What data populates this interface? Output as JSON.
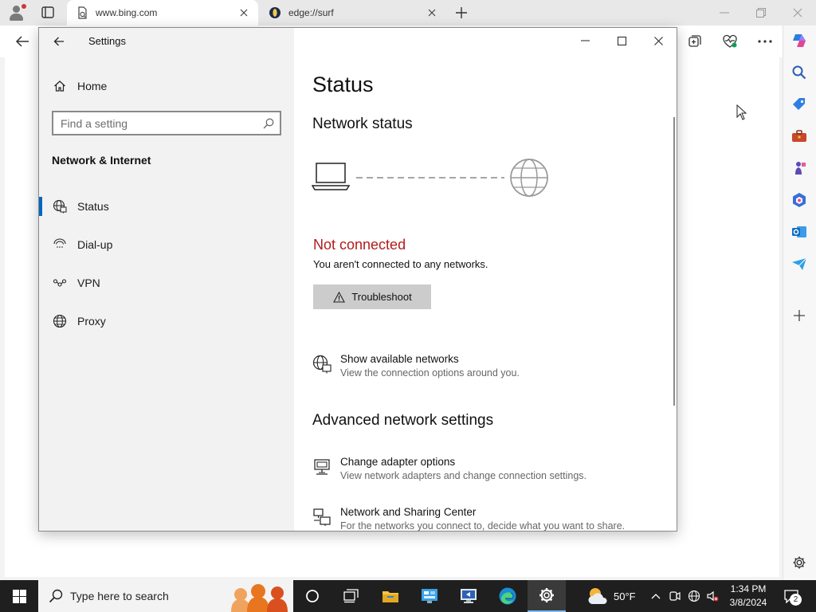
{
  "browser": {
    "tabs": [
      {
        "title": "www.bing.com",
        "active": true
      },
      {
        "title": "edge://surf",
        "active": false
      }
    ]
  },
  "settings": {
    "app_title": "Settings",
    "home_label": "Home",
    "search_placeholder": "Find a setting",
    "section_title": "Network & Internet",
    "nav_items": [
      {
        "label": "Status",
        "icon": "globe-grid-icon",
        "selected": true
      },
      {
        "label": "Dial-up",
        "icon": "dial-up-icon",
        "selected": false
      },
      {
        "label": "VPN",
        "icon": "vpn-icon",
        "selected": false
      },
      {
        "label": "Proxy",
        "icon": "globe-icon",
        "selected": false
      }
    ],
    "page_title": "Status",
    "network_status_heading": "Network status",
    "connection_state": "Not connected",
    "connection_description": "You aren't connected to any networks.",
    "troubleshoot_label": "Troubleshoot",
    "show_networks": {
      "title": "Show available networks",
      "description": "View the connection options around you."
    },
    "advanced_heading": "Advanced network settings",
    "advanced_items": [
      {
        "title": "Change adapter options",
        "description": "View network adapters and change connection settings.",
        "icon": "adapter-icon"
      },
      {
        "title": "Network and Sharing Center",
        "description": "For the networks you connect to, decide what you want to share.",
        "icon": "sharing-center-icon"
      }
    ],
    "colors": {
      "error": "#b31b1b",
      "accent": "#0067c0"
    }
  },
  "taskbar": {
    "search_placeholder": "Type here to search",
    "weather_temp": "50°F",
    "time": "1:34 PM",
    "date": "3/8/2024",
    "notification_count": "2"
  }
}
